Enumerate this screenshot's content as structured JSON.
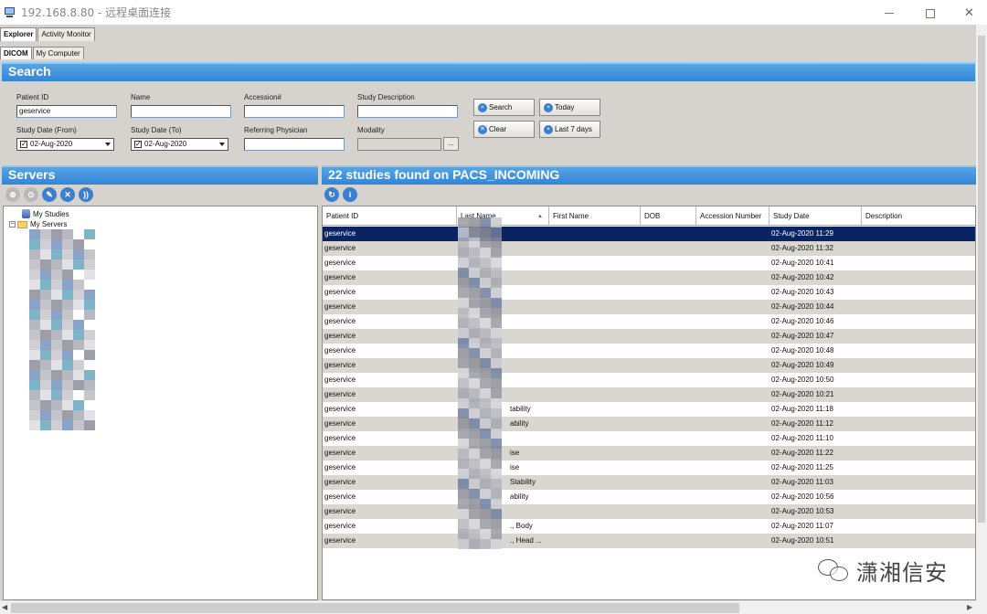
{
  "window": {
    "title": "192.168.8.80 - 远程桌面连接"
  },
  "tabs_top": [
    {
      "label": "Explorer",
      "active": true
    },
    {
      "label": "Activity Monitor",
      "active": false
    }
  ],
  "tabs_sub": [
    {
      "label": "DICOM",
      "active": true
    },
    {
      "label": "My Computer",
      "active": false
    }
  ],
  "search": {
    "title": "Search",
    "patient_id_label": "Patient ID",
    "patient_id_value": "geservice",
    "name_label": "Name",
    "name_value": "",
    "accession_label": "Accession#",
    "accession_value": "",
    "study_desc_label": "Study Description",
    "study_desc_value": "",
    "date_from_label": "Study Date (From)",
    "date_from_value": "02-Aug-2020",
    "date_to_label": "Study Date (To)",
    "date_to_value": "02-Aug-2020",
    "ref_phys_label": "Referring Physician",
    "ref_phys_value": "",
    "modality_label": "Modality",
    "modality_value": "",
    "ellipsis": "...",
    "btn_search": "Search",
    "btn_today": "Today",
    "btn_clear": "Clear",
    "btn_last7": "Last 7 days"
  },
  "servers": {
    "title": "Servers",
    "tree": [
      {
        "label": "My Studies"
      },
      {
        "label": "My Servers"
      }
    ]
  },
  "studies": {
    "title": "22 studies found on PACS_INCOMING",
    "columns": [
      "Patient ID",
      "Last Name",
      "First Name",
      "DOB",
      "Accession Number",
      "Study Date",
      "Description"
    ],
    "rows": [
      {
        "pid": "geservice",
        "last": "",
        "date": "02-Aug-2020 11:29"
      },
      {
        "pid": "geservice",
        "last": "",
        "date": "02-Aug-2020 11:32"
      },
      {
        "pid": "geservice",
        "last": "",
        "date": "02-Aug-2020 10:41"
      },
      {
        "pid": "geservice",
        "last": "",
        "date": "02-Aug-2020 10:42"
      },
      {
        "pid": "geservice",
        "last": "",
        "date": "02-Aug-2020 10:43"
      },
      {
        "pid": "geservice",
        "last": "",
        "date": "02-Aug-2020 10:44"
      },
      {
        "pid": "geservice",
        "last": "",
        "date": "02-Aug-2020 10:46"
      },
      {
        "pid": "geservice",
        "last": "",
        "date": "02-Aug-2020 10:47"
      },
      {
        "pid": "geservice",
        "last": "",
        "date": "02-Aug-2020 10:48"
      },
      {
        "pid": "geservice",
        "last": "",
        "date": "02-Aug-2020 10:49"
      },
      {
        "pid": "geservice",
        "last": "",
        "date": "02-Aug-2020 10:50"
      },
      {
        "pid": "geservice",
        "last": "",
        "date": "02-Aug-2020 10:21"
      },
      {
        "pid": "geservice",
        "last": "tability",
        "date": "02-Aug-2020 11:18"
      },
      {
        "pid": "geservice",
        "last": "ability",
        "date": "02-Aug-2020 11:12"
      },
      {
        "pid": "geservice",
        "last": "",
        "date": "02-Aug-2020 11:10"
      },
      {
        "pid": "geservice",
        "last": "ise",
        "date": "02-Aug-2020 11:22"
      },
      {
        "pid": "geservice",
        "last": "ise",
        "date": "02-Aug-2020 11:25"
      },
      {
        "pid": "geservice",
        "last": "Stability",
        "date": "02-Aug-2020 11:03"
      },
      {
        "pid": "geservice",
        "last": "ability",
        "date": "02-Aug-2020 10:56"
      },
      {
        "pid": "geservice",
        "last": "",
        "date": "02-Aug-2020 10:53"
      },
      {
        "pid": "geservice",
        "last": "., Body",
        "date": "02-Aug-2020 11:07"
      },
      {
        "pid": "geservice",
        "last": "., Head ...",
        "date": "02-Aug-2020 10:51"
      }
    ]
  },
  "watermark": "潇湘信安",
  "colors": {
    "header_blue": "#3286d6",
    "selected_row": "#0a2463",
    "alt_row": "#dad7d3",
    "background": "#d6d3ce"
  }
}
